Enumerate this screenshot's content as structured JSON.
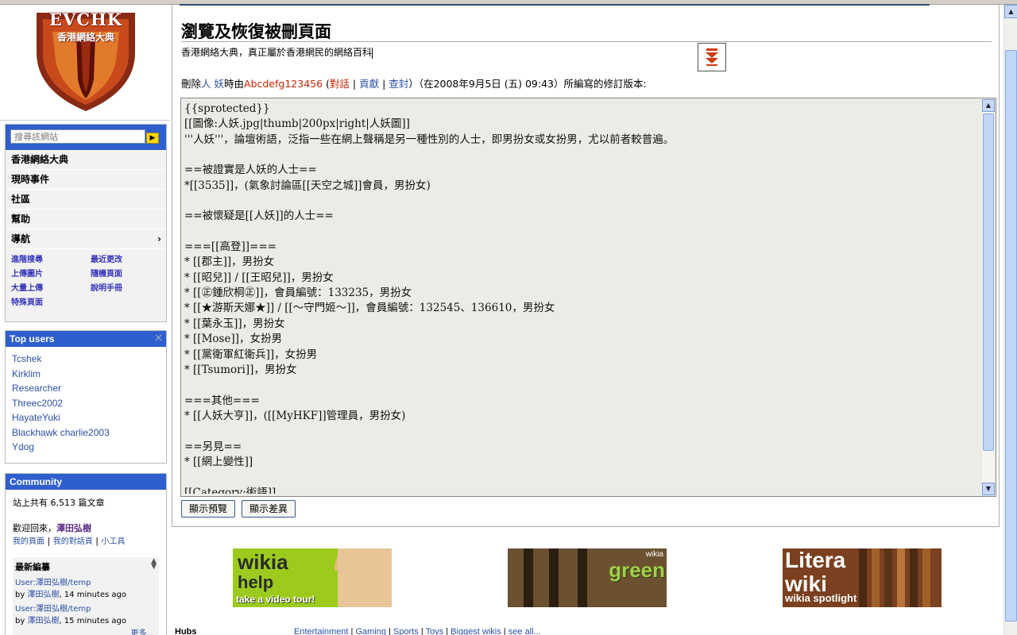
{
  "logo": {
    "url": "EVCHK.WIKIA.COM",
    "brand": "EVCHK",
    "subtitle": "香港網絡大典"
  },
  "search": {
    "placeholder": "搜尋該網站"
  },
  "nav": {
    "items": [
      {
        "label": "香港網絡大典"
      },
      {
        "label": "現時事件"
      },
      {
        "label": "社區"
      },
      {
        "label": "幫助"
      },
      {
        "label": "導航",
        "chevron": "›"
      }
    ],
    "tools": [
      "進階搜尋",
      "最近更改",
      "上傳圖片",
      "隨機頁面",
      "大量上傳",
      "說明手冊",
      "特殊頁面"
    ]
  },
  "top_users": {
    "title": "Top users",
    "close": "✕",
    "users": [
      "Tcshek",
      "Kirklim",
      "Researcher",
      "Threec2002",
      "HayateYuki",
      "Blackhawk charlie2003",
      "Ydog"
    ]
  },
  "community": {
    "title": "Community",
    "stat": "站上共有 6,513 篇文章",
    "welcome_prefix": "歡迎回來，",
    "welcome_name": "澤田弘樹",
    "links": [
      "我的頁面",
      "我的對話頁",
      "小工具"
    ],
    "recent_title": "最新編纂",
    "recent": [
      {
        "page": "User:澤田弘樹/temp",
        "by": "by",
        "user": "澤田弘樹",
        "when": ", 14 minutes ago"
      },
      {
        "page": "User:澤田弘樹/temp",
        "by": "by",
        "user": "澤田弘樹",
        "when": ", 15 minutes ago"
      }
    ],
    "more": "更多..."
  },
  "main": {
    "title": "瀏覽及恢復被刪頁面",
    "tagline": "香港網絡大典，真正屬於香港網民的網絡百科",
    "history": {
      "prefix": "刪除",
      "page": "人 妖",
      "mid": "時由",
      "user": "Abcdefg123456",
      "talk": "對話",
      "contribs": "貢獻",
      "block": "查封",
      "suffix": "）（在2008年9月5日 (五) 09:43）所編寫的修訂版本:"
    },
    "wikitext": "{{sprotected}}\n[[圖像:人妖.jpg|thumb|200px|right|人妖圖]]\n'''人妖'''，論壇術語，泛指一些在網上聲稱是另一種性別的人士，即男扮女或女扮男，尤以前者較普遍。\n\n==被證實是人妖的人士==\n*[[3535]]，(氣象討論區[[天空之城]]會員，男扮女)\n\n==被懷疑是[[人妖]]的人士==\n\n===[[高登]]===\n* [[郡主]]，男扮女\n* [[昭兒]] / [[王昭兒]]，男扮女\n* [[㊣鍾欣桐㊣]]，會員編號：133235，男扮女\n* [[★游斯天娜★]] / [[～守門姬～]]，會員編號：132545、136610，男扮女\n* [[葉永玉]]，男扮女\n* [[Mose]]，女扮男\n* [[黨衛軍紅衛兵]]，女扮男\n* [[Tsumori]]，男扮女\n\n===其他===\n* [[人妖大亨]]，([[MyHKF]]管理員，男扮女)\n\n==另見==\n* [[網上變性]]\n\n[[Category:術語]]",
    "buttons": {
      "preview": "顯示預覽",
      "diff": "顯示差異"
    }
  },
  "banners": {
    "help": {
      "line1": "wikia",
      "line2": "help",
      "line3": "take a video tour!"
    },
    "green": {
      "line1": "wikia",
      "line2": "green"
    },
    "litera": {
      "line1": "Litera",
      "line2": "wiki",
      "line3": "wikia spotlight"
    }
  },
  "footer": {
    "hubs_label": "Hubs",
    "links": [
      "Entertainment",
      "Gaming",
      "Sports",
      "Toys",
      "Biggest wikis",
      "see all..."
    ]
  },
  "colors": {
    "accent": "#2f5fcd",
    "link": "#2b4fa8",
    "user_link": "#cc2200",
    "editor_bg": "#ecece6"
  }
}
